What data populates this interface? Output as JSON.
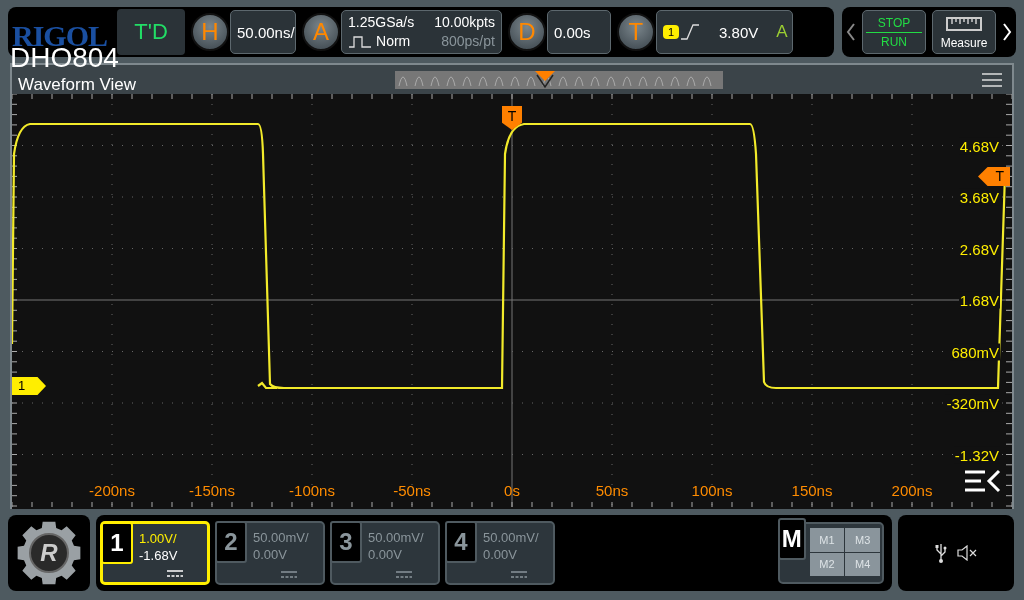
{
  "brand": {
    "logo": "RIGOL",
    "model": "DHO804"
  },
  "top_bar": {
    "mode_button": "T'D",
    "horizontal": {
      "letter": "H",
      "scale": "50.00ns/"
    },
    "acquire": {
      "letter": "A",
      "sample_rate": "1.25GSa/s",
      "mode": "Norm",
      "memory_depth": "10.00kpts",
      "resolution": "800ps/pt"
    },
    "delay": {
      "letter": "D",
      "value": "0.00s"
    },
    "trigger": {
      "letter": "T",
      "source": "1",
      "level": "3.80V",
      "sweep": "A"
    },
    "stop_run": {
      "stop": "STOP",
      "run": "RUN"
    },
    "measure": {
      "label": "Measure"
    }
  },
  "waveform_view": {
    "title": "Waveform View",
    "trigger_position_marker": "T",
    "trigger_level_marker": "T",
    "channel_marker": "1",
    "x_labels": [
      "-200ns",
      "-150ns",
      "-100ns",
      "-50ns",
      "0s",
      "50ns",
      "100ns",
      "150ns",
      "200ns"
    ],
    "y_labels": [
      "4.68V",
      "3.68V",
      "2.68V",
      "1.68V",
      "680mV",
      "-320mV",
      "-1.32V"
    ]
  },
  "home_button": {
    "letter": "R"
  },
  "channels": [
    {
      "number": "1",
      "scale": "1.00V/",
      "offset": "-1.68V",
      "on": true
    },
    {
      "number": "2",
      "scale": "50.00mV/",
      "offset": "0.00V",
      "on": false
    },
    {
      "number": "3",
      "scale": "50.00mV/",
      "offset": "0.00V",
      "on": false
    },
    {
      "number": "4",
      "scale": "50.00mV/",
      "offset": "0.00V",
      "on": false
    }
  ],
  "math": {
    "letter": "M",
    "slots": [
      "M1",
      "M3",
      "M2",
      "M4"
    ]
  }
}
